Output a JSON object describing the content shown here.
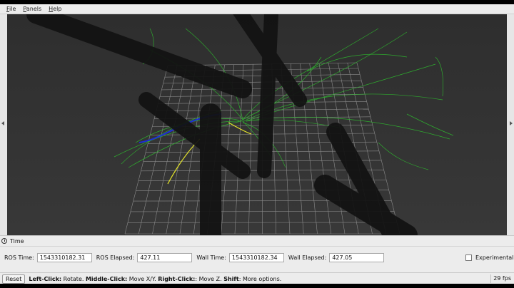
{
  "menubar": {
    "items": [
      {
        "label": "File",
        "mnemonic": "F",
        "rest": "ile"
      },
      {
        "label": "Panels",
        "mnemonic": "P",
        "rest": "anels"
      },
      {
        "label": "Help",
        "mnemonic": "H",
        "rest": "elp"
      }
    ]
  },
  "time_panel": {
    "title": "Time",
    "ros_time_label": "ROS Time:",
    "ros_time_value": "1543310182.31",
    "ros_elapsed_label": "ROS Elapsed:",
    "ros_elapsed_value": "427.11",
    "wall_time_label": "Wall Time:",
    "wall_time_value": "1543310182.34",
    "wall_elapsed_label": "Wall Elapsed:",
    "wall_elapsed_value": "427.05",
    "experimental_label": "Experimental"
  },
  "statusbar": {
    "reset_label": "Reset",
    "hint_left_bold": "Left-Click:",
    "hint_left": " Rotate. ",
    "hint_middle_bold": "Middle-Click:",
    "hint_middle": " Move X/Y. ",
    "hint_right_bold": "Right-Click:",
    "hint_right": ": Move Z. ",
    "hint_shift_bold": "Shift",
    "hint_shift": ": More options.",
    "fps": "29 fps"
  },
  "colors": {
    "viewport_bg": "#303030",
    "grid": "#9a9a9a",
    "trajectory_green": "#2eb82e",
    "trajectory_blue": "#1e2fd6",
    "trajectory_yellow": "#e6e62a",
    "obstacle": "#121212"
  }
}
